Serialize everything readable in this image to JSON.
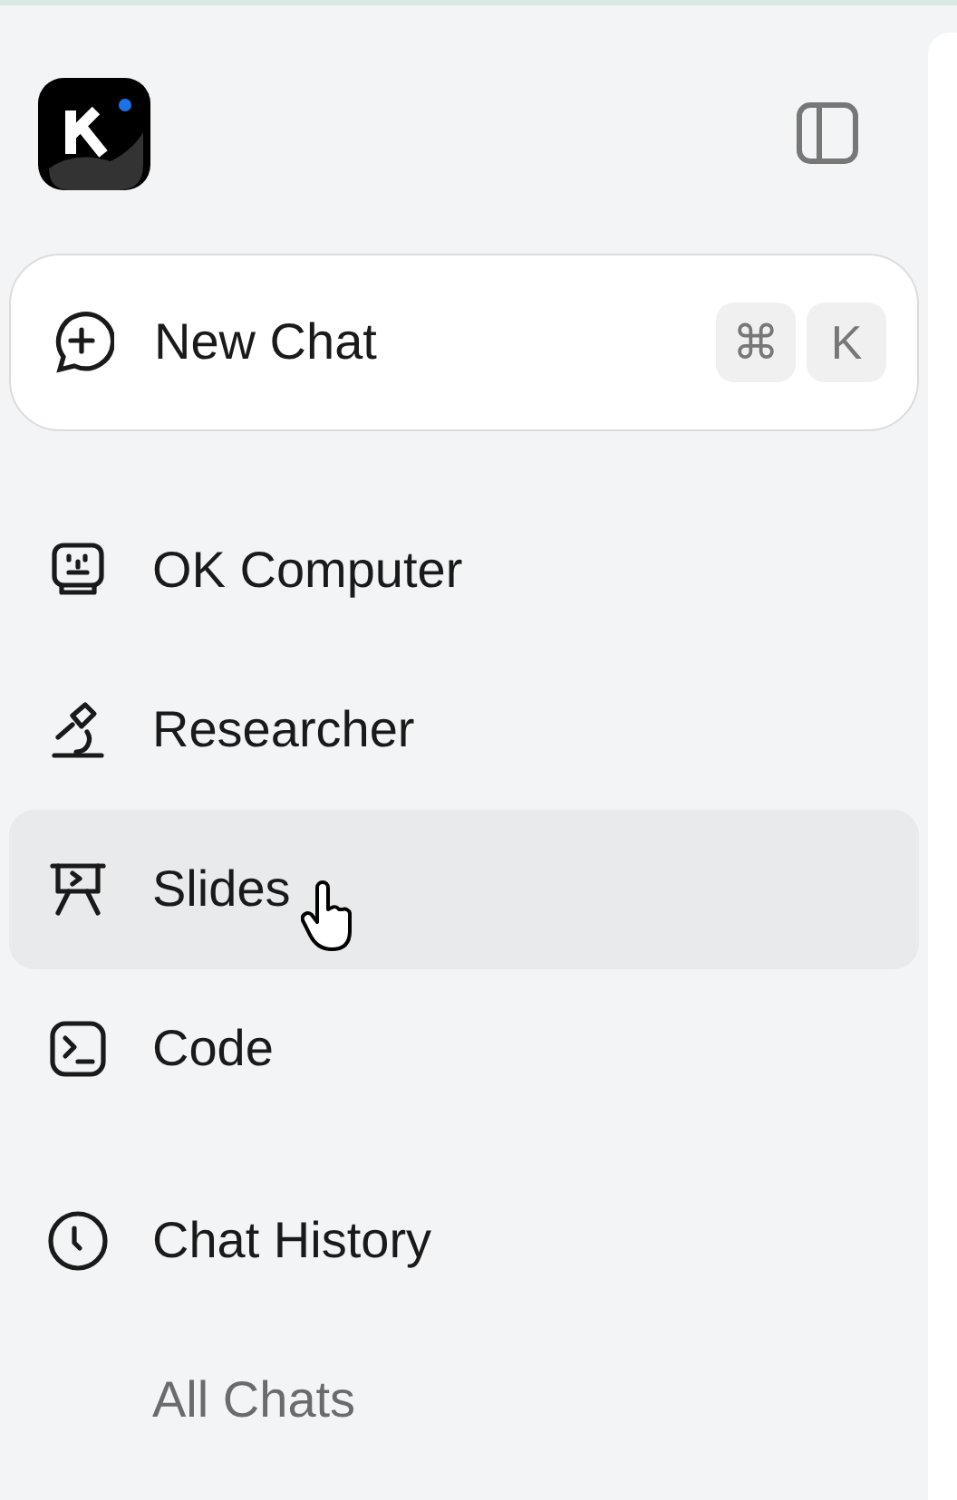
{
  "new_chat": {
    "label": "New Chat",
    "shortcut": [
      "⌘",
      "K"
    ]
  },
  "nav": [
    {
      "kind": "computer",
      "label": "OK Computer",
      "selected": false
    },
    {
      "kind": "microscope",
      "label": "Researcher",
      "selected": false
    },
    {
      "kind": "slides",
      "label": "Slides",
      "selected": true
    },
    {
      "kind": "code",
      "label": "Code",
      "selected": false
    }
  ],
  "history": {
    "label": "Chat History",
    "items": [
      {
        "label": "All Chats"
      }
    ]
  }
}
